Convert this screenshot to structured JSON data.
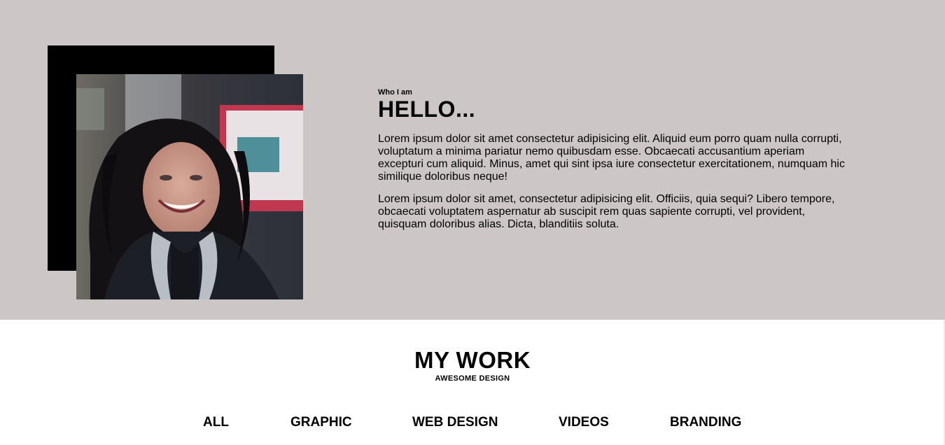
{
  "about": {
    "eyebrow": "Who I am",
    "heading": "HELLO...",
    "paragraphs": [
      "Lorem ipsum dolor sit amet consectetur adipisicing elit. Aliquid eum porro quam nulla corrupti, voluptatum a minima pariatur nemo quibusdam esse. Obcaecati accusantium aperiam excepturi cum aliquid. Minus, amet qui sint ipsa iure consectetur exercitationem, numquam hic similique doloribus neque!",
      "Lorem ipsum dolor sit amet, consectetur adipisicing elit. Officiis, quia sequi? Libero tempore, obcaecati voluptatem aspernatur ab suscipit rem quas sapiente corrupti, vel provident, quisquam doloribus alias. Dicta, blanditiis soluta."
    ]
  },
  "work": {
    "title": "MY WORK",
    "subtitle": "AWESOME DESIGN",
    "filters": [
      "ALL",
      "GRAPHIC",
      "WEB DESIGN",
      "VIDEOS",
      "BRANDING"
    ]
  },
  "colors": {
    "about_background": "#cdc6c6",
    "page_background": "#ffffff",
    "accent_block": "#000000"
  }
}
